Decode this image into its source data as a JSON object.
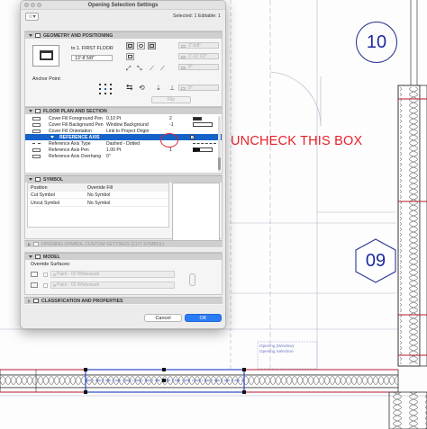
{
  "dialog": {
    "title": "Opening Selection Settings",
    "selected_text": "Selected: 1 Editable: 1",
    "favorites_icon": "star-icon",
    "cancel_label": "Cancel",
    "ok_label": "OK"
  },
  "sections": {
    "geometry": "GEOMETRY AND POSITIONING",
    "floor_plan": "FLOOR PLAN AND SECTION",
    "symbol": "SYMBOL",
    "custom": "OPENING SYMBOL CUSTOM SETTINGS (CUT SYMBOL)",
    "model": "MODEL",
    "classification": "CLASSIFICATION AND PROPERTIES"
  },
  "geometry": {
    "floor_label": "to 1. FIRST FLOOR",
    "elevation": "13'-8 5/8\"",
    "width_value": "3'-5/8\"",
    "height_value": "3'-10 1/2\"",
    "field3_value": "0\"",
    "field4_value": "0\"",
    "anchor_label": "Anchor Point:",
    "angle_value": "0°",
    "flip_label": "Flip"
  },
  "floor_plan": {
    "rows": [
      {
        "name": "Cover Fill Foreground Pen",
        "value": "0.10 Pt",
        "extra": "2"
      },
      {
        "name": "Cover Fill Background Pen",
        "value": "Window Background",
        "extra": "-1"
      },
      {
        "name": "Cover Fill Orientation",
        "value": "Link to Project Origin",
        "extra": ""
      },
      {
        "name": "REFERENCE AXIS",
        "value": "",
        "extra": ""
      },
      {
        "name": "Reference Axis Type",
        "value": "Dashed - Dotted",
        "extra": ""
      },
      {
        "name": "Reference Axis Pen",
        "value": "1.00 Pt",
        "extra": "1"
      },
      {
        "name": "Reference Axis Overhang",
        "value": "0\"",
        "extra": ""
      }
    ]
  },
  "symbol": {
    "headers": [
      "Position",
      "Override Fill"
    ],
    "rows": [
      {
        "position": "Cut Symbol",
        "value": "No Symbol"
      },
      {
        "position": "Uncut Symbol",
        "value": "No Symbol"
      }
    ]
  },
  "model": {
    "override_label": "Override Surfaces:",
    "surface_1": "Paint - 02 Whitewash",
    "surface_2": "Paint - 02 Whitewash"
  },
  "annotation": {
    "text": "UNCHECK THIS BOX",
    "color": "#e8202a"
  },
  "markers": {
    "top": "10",
    "bottom": "09",
    "color": "#1c2a9e"
  },
  "drawing": {
    "tag_line1": "Opening (Window)",
    "tag_line2": "Opening Selection"
  }
}
